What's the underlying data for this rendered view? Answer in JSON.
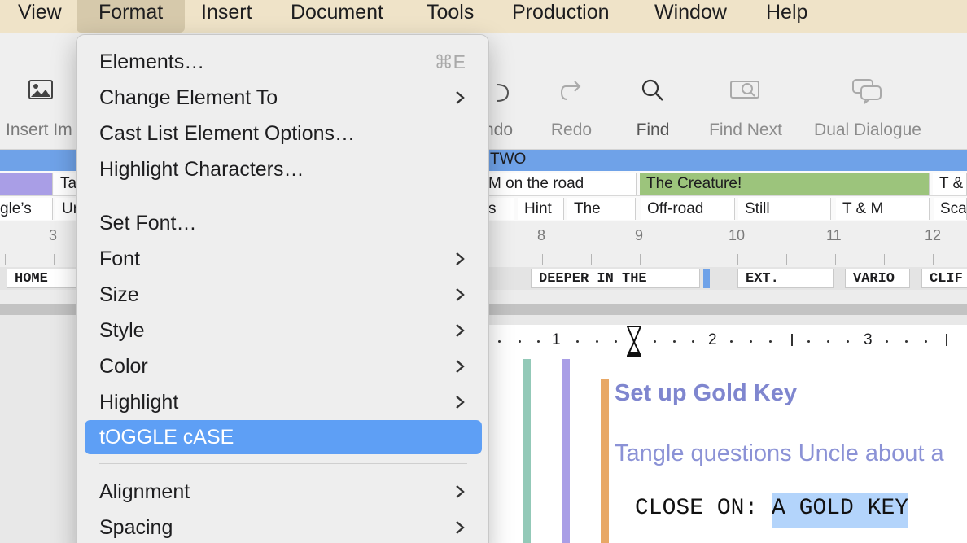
{
  "menubar": {
    "items": [
      "View",
      "Format",
      "Insert",
      "Document",
      "Tools",
      "Production",
      "Window",
      "Help"
    ]
  },
  "toolbar": {
    "insert_image": "Insert Im",
    "undo": "ndo",
    "redo": "Redo",
    "find": "Find",
    "find_next": "Find Next",
    "dual_dialogue": "Dual Dialogue"
  },
  "outline": {
    "act_label": "TWO",
    "sequence_cells": [
      "Ta",
      "M on the road",
      "The Creature!",
      "T &"
    ],
    "scene_cells": [
      "gle’s",
      "Ur",
      "s",
      "Hint",
      "The",
      "Off-road",
      "Still",
      "T & M",
      "Sca"
    ],
    "ruler_numbers": [
      "3",
      "8",
      "9",
      "10",
      "11",
      "12"
    ],
    "slugs": [
      "HOME",
      "DEEPER IN THE",
      "EXT.",
      "VARIO",
      "CLIF"
    ]
  },
  "doc_ruler": {
    "labels": [
      "1",
      "2",
      "3"
    ]
  },
  "document": {
    "heading": "Set up Gold Key",
    "synopsis": "Tangle questions Uncle about a",
    "script_prefix": "CLOSE ON: ",
    "script_selected": "A GOLD KEY"
  },
  "format_menu": {
    "elements": "Elements…",
    "elements_shortcut": "⌘E",
    "change_element": "Change Element To",
    "cast_list": "Cast List Element Options…",
    "highlight_chars": "Highlight Characters…",
    "set_font": "Set Font…",
    "font": "Font",
    "size": "Size",
    "style": "Style",
    "color": "Color",
    "highlight": "Highlight",
    "toggle_case": "tOGGLE cASE",
    "alignment": "Alignment",
    "spacing": "Spacing"
  },
  "colors": {
    "menu_highlight": "#5e9ff5",
    "act_bar": "#6fa2e8",
    "creature_cell": "#9cc47c",
    "purple_cell": "#a99ee6",
    "heading_text": "#7f86cf",
    "selection": "#b3d4fb"
  },
  "icons": [
    "image-icon",
    "undo-icon",
    "redo-icon",
    "magnifier-icon",
    "find-next-icon",
    "dual-dialogue-icon",
    "chevron-right-icon",
    "cursor-icon"
  ]
}
